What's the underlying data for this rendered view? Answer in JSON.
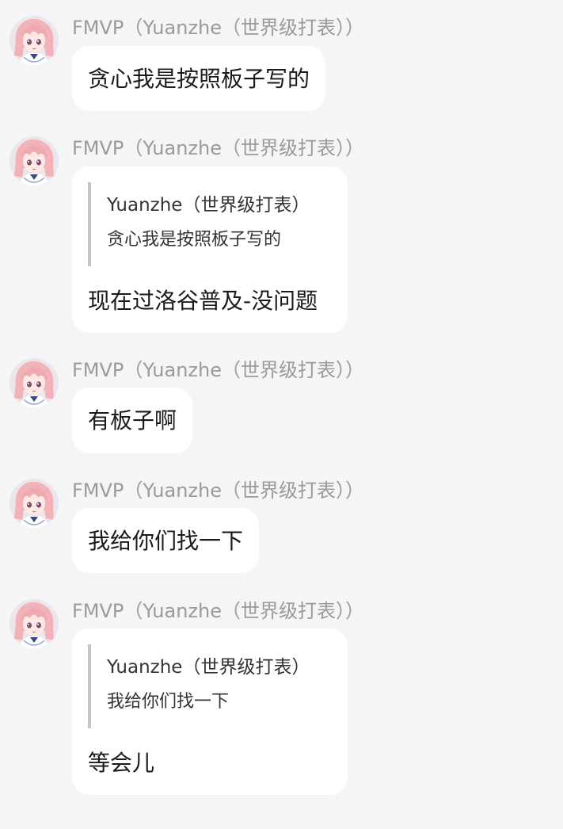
{
  "messages": [
    {
      "sender": "FMVP（Yuanzhe（世界级打表））",
      "text": "贪心我是按照板子写的"
    },
    {
      "sender": "FMVP（Yuanzhe（世界级打表））",
      "quote": {
        "author": "Yuanzhe（世界级打表）",
        "text": "贪心我是按照板子写的"
      },
      "text": "现在过洛谷普及-没问题"
    },
    {
      "sender": "FMVP（Yuanzhe（世界级打表））",
      "text": "有板子啊"
    },
    {
      "sender": "FMVP（Yuanzhe（世界级打表））",
      "text": "我给你们找一下"
    },
    {
      "sender": "FMVP（Yuanzhe（世界级打表））",
      "quote": {
        "author": "Yuanzhe（世界级打表）",
        "text": "我给你们找一下"
      },
      "text": "等会儿"
    }
  ],
  "colors": {
    "background": "#f5f5f5",
    "bubble": "#ffffff",
    "sender": "#9a9a9a",
    "quote_bar": "#c4c4c4"
  },
  "icons": {
    "avatar": "anime-girl-avatar-icon"
  }
}
